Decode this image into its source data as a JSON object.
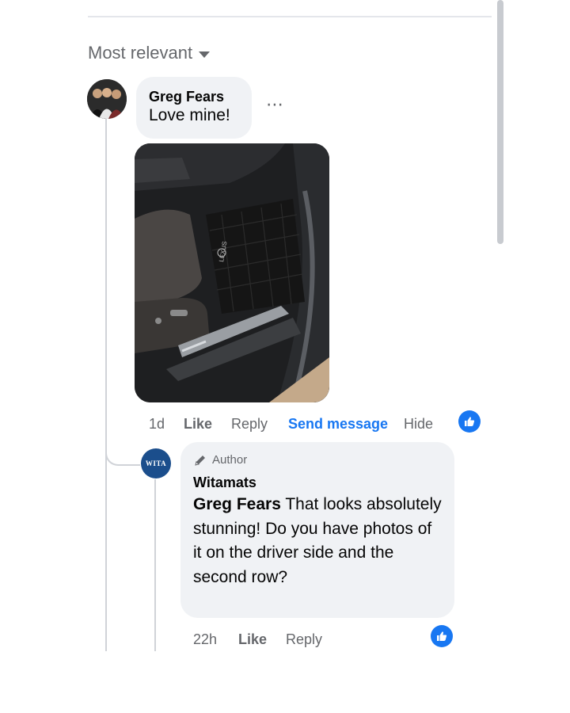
{
  "sort": {
    "label": "Most relevant"
  },
  "comment": {
    "author": "Greg Fears",
    "text": "Love mine!",
    "more": "⋯",
    "time": "1d",
    "actions": {
      "like": "Like",
      "reply": "Reply",
      "send_message": "Send message",
      "hide": "Hide"
    },
    "reaction_icon": "like-icon"
  },
  "reply": {
    "badge": "Author",
    "author": "Witamats",
    "mention": "Greg Fears",
    "text": " That looks absolutely stunning! Do you have photos of it on the driver side and the second row?",
    "time": "22h",
    "actions": {
      "like": "Like",
      "reply": "Reply"
    },
    "avatar_logo": "WITA",
    "reaction_icon": "like-icon"
  },
  "colors": {
    "link_blue": "#1877f2",
    "secondary_text": "#65676b",
    "bubble_bg": "#f0f2f5",
    "brand_avatar": "#1b4e8c"
  }
}
